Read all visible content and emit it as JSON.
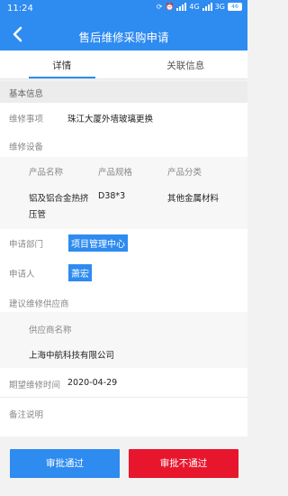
{
  "status_bar": {
    "time": "11:24",
    "network_1": "4G",
    "network_2": "3G",
    "battery": "46"
  },
  "nav": {
    "title": "售后维修采购申请"
  },
  "tabs": [
    {
      "label": "详情",
      "active": true
    },
    {
      "label": "关联信息",
      "active": false
    }
  ],
  "section": {
    "title": "基本信息"
  },
  "fields": {
    "repair_item": {
      "label": "维修事项",
      "value": "珠江大厦外墙玻璃更换"
    },
    "repair_equipment": {
      "label": "维修设备"
    },
    "department": {
      "label": "申请部门",
      "value": "项目管理中心"
    },
    "applicant": {
      "label": "申请人",
      "value": "萧宏"
    },
    "supplier": {
      "label": "建议维修供应商"
    },
    "expected_time": {
      "label": "期望维修时间",
      "value": "2020-04-29"
    },
    "remark": {
      "label": "备注说明"
    }
  },
  "equipment_table": {
    "headers": [
      "产品名称",
      "产品规格",
      "产品分类"
    ],
    "rows": [
      [
        "铝及铝合金热挤",
        "D38*3",
        "其他金属材料"
      ]
    ],
    "row_wrap": "压管"
  },
  "supplier_table": {
    "header": "供应商名称",
    "value": "上海中航科技有限公司"
  },
  "buttons": {
    "approve": "审批通过",
    "reject": "审批不通过"
  },
  "colors": {
    "primary": "#2e8bf0",
    "danger": "#e8162d"
  }
}
